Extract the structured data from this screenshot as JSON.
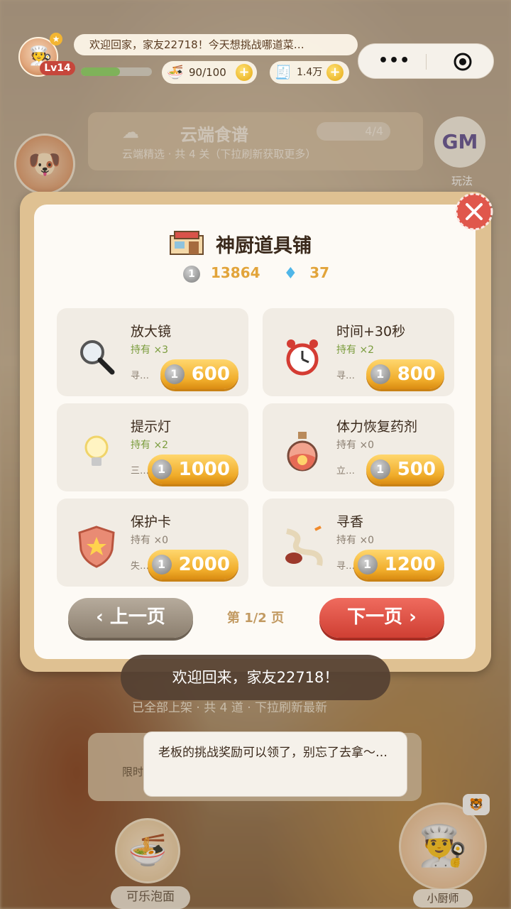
{
  "header": {
    "level": "Lv14",
    "welcome": "欢迎回家，家友22718！今天想挑战哪道菜…",
    "xp_progress": 0.55,
    "stamina": "90/100",
    "coins": "1.4万"
  },
  "icons": {
    "avatar": "chef-avatar",
    "stamina": "noodle-bowl-icon",
    "coins": "cash-register-icon",
    "more": "more-dots-icon",
    "close_mini": "target-icon",
    "close_modal": "close-icon"
  },
  "background": {
    "recipe_title": "云端食谱",
    "recipe_subtitle": "云端精选 · 共 4 关（下拉刷新获取更多）",
    "recipe_count": "4/4",
    "gm_text": "GM",
    "gm_label": "玩法",
    "note": "已全部上架 · 共 4 道 · 下拉刷新最新",
    "limit_text": "限时",
    "bowl_label": "可乐泡面",
    "chef_label": "小厨师"
  },
  "shop": {
    "title": "神厨道具铺",
    "coins": "13864",
    "gems": "37",
    "page": "第 1/2 页",
    "prev_label": "‹ 上一页",
    "next_label": "下一页 ›",
    "items": [
      {
        "name": "放大镜",
        "owned": "持有 ×3",
        "desc": "寻…",
        "price": "600",
        "icon": "magnifier-icon"
      },
      {
        "name": "时间+30秒",
        "owned": "持有 ×2",
        "desc": "寻…",
        "price": "800",
        "icon": "alarm-clock-icon"
      },
      {
        "name": "提示灯",
        "owned": "持有 ×2",
        "desc": "三…",
        "price": "1000",
        "icon": "lightbulb-icon"
      },
      {
        "name": "体力恢复药剂",
        "owned": "持有 ×0",
        "desc": "立…",
        "price": "500",
        "icon": "potion-icon"
      },
      {
        "name": "保护卡",
        "owned": "持有 ×0",
        "desc": "失…",
        "price": "2000",
        "icon": "shield-icon"
      },
      {
        "name": "寻香",
        "owned": "持有 ×0",
        "desc": "寻…",
        "price": "1200",
        "icon": "incense-icon"
      }
    ]
  },
  "toast": "欢迎回来，家友22718！",
  "chat": "老板的挑战奖励可以领了，别忘了去拿～…",
  "colors": {
    "accent_gold": "#f0ac2a",
    "next_red": "#cf3f33",
    "owned_green": "#7a9c3c"
  }
}
